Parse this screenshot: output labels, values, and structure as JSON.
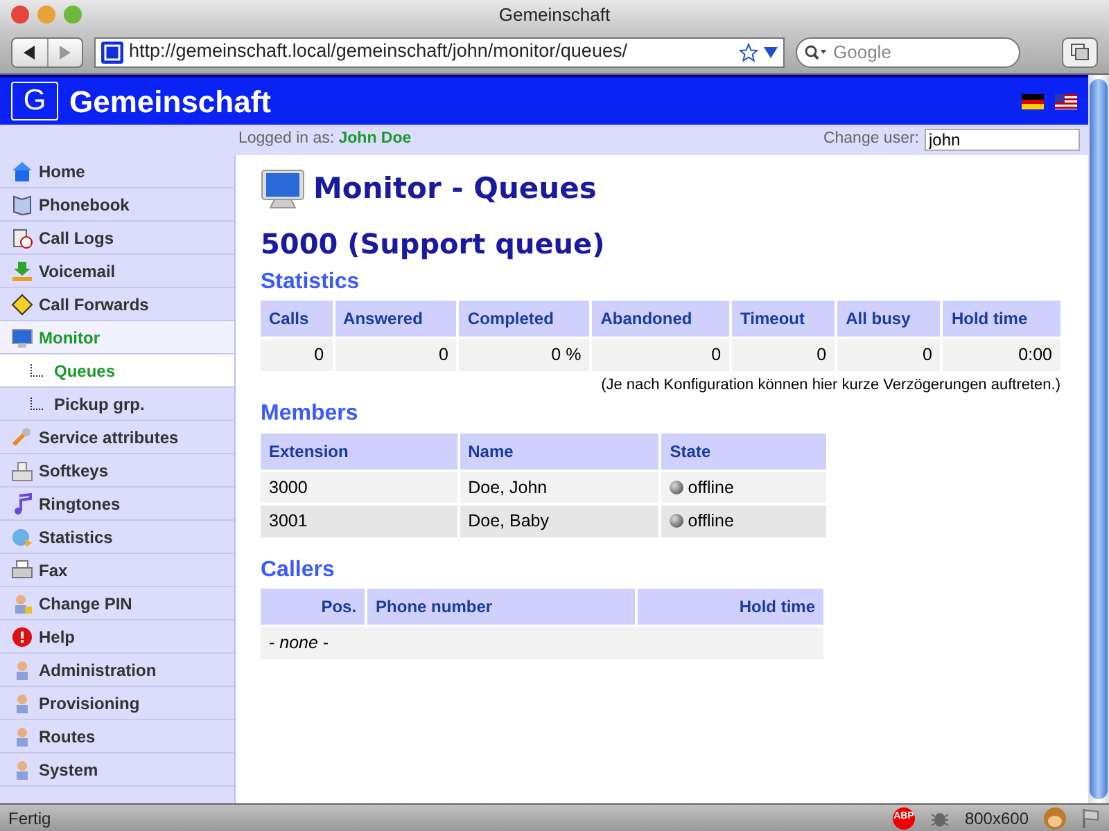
{
  "window": {
    "title": "Gemeinschaft"
  },
  "toolbar": {
    "url": "http://gemeinschaft.local/gemeinschaft/john/monitor/queues/",
    "search": {
      "placeholder": "Google"
    }
  },
  "header": {
    "logo_mark": "G",
    "title": "Gemeinschaft"
  },
  "user_bar": {
    "label": "Logged in as:",
    "user": "John Doe",
    "change_label": "Change user:",
    "change_value": "john"
  },
  "sidebar": {
    "items": [
      {
        "label": "Home",
        "selected": false
      },
      {
        "label": "Phonebook",
        "selected": false
      },
      {
        "label": "Call Logs",
        "selected": false
      },
      {
        "label": "Voicemail",
        "selected": false
      },
      {
        "label": "Call Forwards",
        "selected": false
      },
      {
        "label": "Monitor",
        "selected": true,
        "children": [
          {
            "label": "Queues",
            "selected": true
          },
          {
            "label": "Pickup grp.",
            "selected": false
          }
        ]
      },
      {
        "label": "Service attributes",
        "selected": false
      },
      {
        "label": "Softkeys",
        "selected": false
      },
      {
        "label": "Ringtones",
        "selected": false
      },
      {
        "label": "Statistics",
        "selected": false
      },
      {
        "label": "Fax",
        "selected": false
      },
      {
        "label": "Change PIN",
        "selected": false
      },
      {
        "label": "Help",
        "selected": false
      },
      {
        "label": "Administration",
        "selected": false
      },
      {
        "label": "Provisioning",
        "selected": false
      },
      {
        "label": "Routes",
        "selected": false
      },
      {
        "label": "System",
        "selected": false
      }
    ]
  },
  "page": {
    "title": "Monitor - Queues",
    "queue": "5000 (Support queue)",
    "statistics": {
      "heading": "Statistics",
      "columns": [
        "Calls",
        "Answered",
        "Completed",
        "Abandoned",
        "Timeout",
        "All busy",
        "Hold time"
      ],
      "row": [
        "0",
        "0",
        "0 %",
        "0",
        "0",
        "0",
        "0:00"
      ],
      "note": "(Je nach Konfiguration können hier kurze Verzögerungen auftreten.)"
    },
    "members": {
      "heading": "Members",
      "columns": [
        "Extension",
        "Name",
        "State"
      ],
      "rows": [
        {
          "extension": "3000",
          "name": "Doe, John",
          "state": "offline"
        },
        {
          "extension": "3001",
          "name": "Doe, Baby",
          "state": "offline"
        }
      ]
    },
    "callers": {
      "heading": "Callers",
      "columns": [
        "Pos.",
        "Phone number",
        "Hold time"
      ],
      "empty": "- *none* -"
    }
  },
  "status_bar": {
    "text": "Fertig",
    "adblock": "ABP",
    "size": "800x600"
  }
}
